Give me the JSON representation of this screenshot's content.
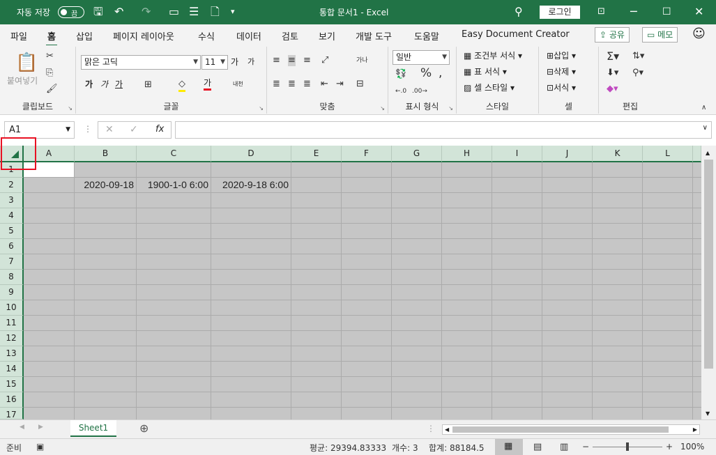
{
  "titlebar": {
    "autosave_label": "자동 저장",
    "autosave_state": "끔",
    "doc_title": "통합 문서1  -  Excel",
    "login_label": "로그인"
  },
  "tabs": [
    "파일",
    "홈",
    "삽입",
    "페이지 레이아웃",
    "수식",
    "데이터",
    "검토",
    "보기",
    "개발 도구",
    "도움말",
    "Easy Document Creator"
  ],
  "share_label": "공유",
  "memo_label": "메모",
  "ribbon": {
    "clipboard": {
      "label": "클립보드",
      "paste": "붙여넣기"
    },
    "font": {
      "label": "글꼴",
      "font_name": "맑은 고딕",
      "font_size": "11",
      "bold": "가",
      "italic": "가",
      "underline": "가",
      "grow": "가",
      "shrink": "가",
      "phonetic": "내천",
      "color_a": "가"
    },
    "align": {
      "label": "맞춤"
    },
    "number": {
      "label": "표시 형식",
      "format": "일반"
    },
    "styles": {
      "label": "스타일",
      "cond": "조건부 서식",
      "table": "표 서식",
      "cell": "셀 스타일"
    },
    "cells": {
      "label": "셀",
      "insert": "삽입",
      "delete": "삭제",
      "format": "서식"
    },
    "edit": {
      "label": "편집"
    }
  },
  "formula": {
    "namebox": "A1",
    "content": ""
  },
  "columns": [
    "A",
    "B",
    "C",
    "D",
    "E",
    "F",
    "G",
    "H",
    "I",
    "J",
    "K",
    "L"
  ],
  "rows": [
    "1",
    "2",
    "3",
    "4",
    "5",
    "6",
    "7",
    "8",
    "9",
    "10",
    "11",
    "12",
    "13",
    "14",
    "15",
    "16",
    "17"
  ],
  "cells": {
    "B2": "2020-09-18",
    "C2": "1900-1-0 6:00",
    "D2": "2020-9-18 6:00"
  },
  "sheets": [
    "Sheet1"
  ],
  "status": {
    "ready": "준비",
    "average": "평균: 29394.83333",
    "count": "개수: 3",
    "sum": "합계: 88184.5",
    "zoom": "100%"
  },
  "colors": {
    "accent": "#217346",
    "selection": "#c6c6c6",
    "highlight_box": "#e81123"
  }
}
